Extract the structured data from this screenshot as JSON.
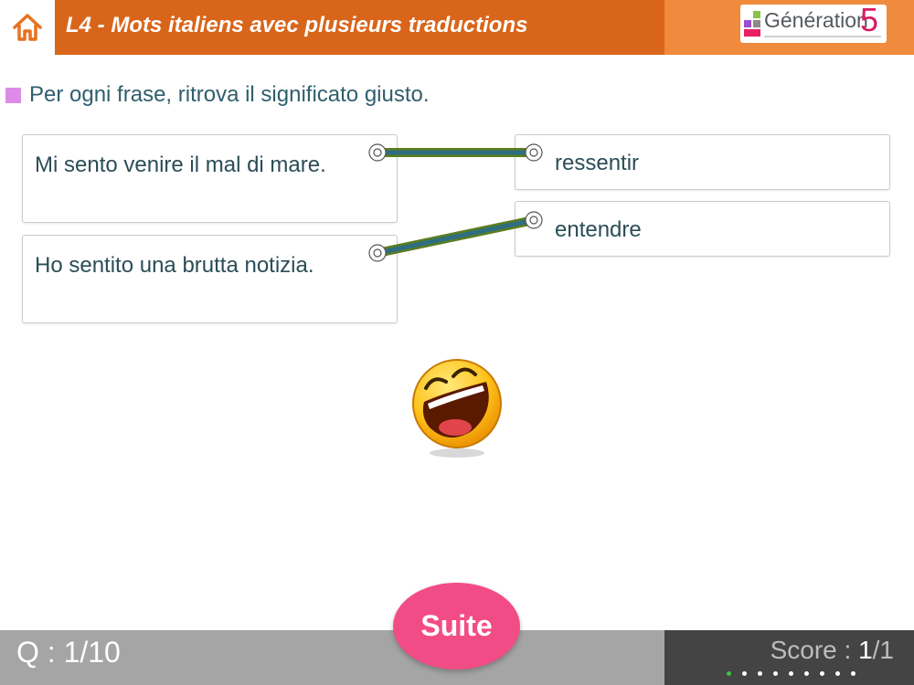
{
  "header": {
    "home_icon": "home-icon",
    "title": "L4 - Mots italiens avec plusieurs traductions",
    "logo_text": "Génération",
    "logo_number": "5",
    "accent_color": "#d9651a"
  },
  "instruction": {
    "text": "Per ogni frase, ritrova il significato giusto."
  },
  "left_items": [
    {
      "text": "Mi sento venire il mal di mare."
    },
    {
      "text": "Ho sentito una brutta notizia."
    }
  ],
  "right_items": [
    {
      "text": "ressentir"
    },
    {
      "text": "entendre"
    }
  ],
  "feedback": {
    "icon": "laughing-smiley-icon"
  },
  "footer": {
    "question_prefix": "Q : ",
    "question_current": "1",
    "question_total": "/10",
    "score_prefix": "Score : ",
    "score_current": "1",
    "score_total": "/1",
    "suite_label": "Suite",
    "progress_total": 9,
    "progress_current": 1
  }
}
